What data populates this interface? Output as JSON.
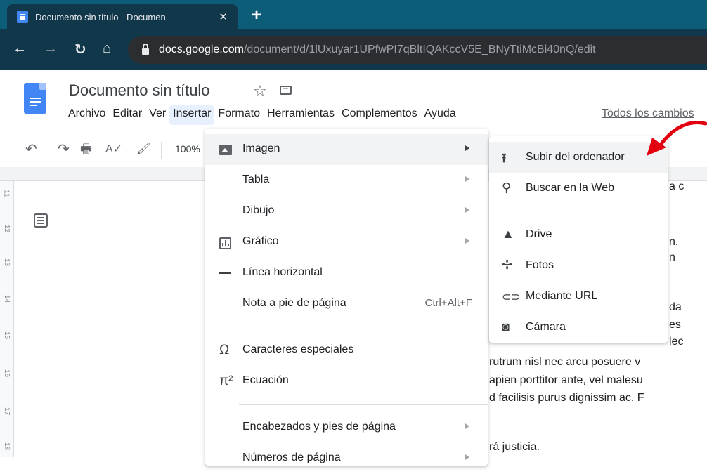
{
  "browser": {
    "tab_title": "Documento sin título - Documen",
    "tab_close": "✕",
    "new_tab": "+",
    "url_host": "docs.google.com",
    "url_path": "/document/d/1lUxuyar1UPfwPI7qBltIQAKccV5E_BNyTtiMcBi40nQ/edit"
  },
  "docs": {
    "title": "Documento sin título",
    "menus": [
      "Archivo",
      "Editar",
      "Ver",
      "Insertar",
      "Formato",
      "Herramientas",
      "Complementos",
      "Ayuda"
    ],
    "last_edit": "Todos los cambios"
  },
  "toolbar": {
    "zoom": "100%"
  },
  "ruler": {
    "marks": [
      "11",
      "12",
      "13",
      "14",
      "15",
      "16",
      "17",
      "18"
    ]
  },
  "document_text": [
    "a c",
    "n,",
    "n",
    "da",
    "es",
    "lec",
    "rutrum nisl nec arcu posuere v",
    "apien porttitor ante, vel malesu",
    "d facilisis purus dignissim ac. F",
    "rá justicia."
  ],
  "insert_menu": {
    "items": [
      {
        "label": "Imagen",
        "icon": "image-icon",
        "submenu": true,
        "highlighted": true
      },
      {
        "label": "Tabla",
        "submenu": true
      },
      {
        "label": "Dibujo",
        "submenu": true
      },
      {
        "label": "Gráfico",
        "icon": "chart-icon",
        "submenu": true
      },
      {
        "label": "Línea horizontal",
        "icon": "horizontal-line-icon"
      },
      {
        "label": "Nota a pie de página",
        "shortcut": "Ctrl+Alt+F"
      },
      {
        "label": "Caracteres especiales",
        "icon": "omega-icon"
      },
      {
        "label": "Ecuación",
        "icon": "pi-icon"
      },
      {
        "label": "Encabezados y pies de página",
        "submenu": true
      },
      {
        "label": "Números de página",
        "submenu": true
      }
    ]
  },
  "image_submenu": {
    "items": [
      {
        "label": "Subir del ordenador",
        "icon": "upload-icon",
        "highlighted": true
      },
      {
        "label": "Buscar en la Web",
        "icon": "search-icon"
      },
      {
        "label": "Drive",
        "icon": "drive-icon"
      },
      {
        "label": "Fotos",
        "icon": "photos-icon"
      },
      {
        "label": "Mediante URL",
        "icon": "link-icon"
      },
      {
        "label": "Cámara",
        "icon": "camera-icon"
      }
    ]
  },
  "colors": {
    "tabbar": "#0d5c78",
    "toolbar_dark": "#11374a",
    "docs_blue": "#4285f4",
    "annotation_red": "#e3000f"
  }
}
